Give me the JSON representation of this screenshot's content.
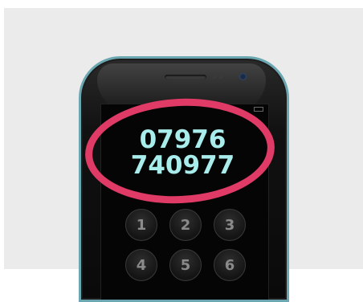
{
  "phone_number": {
    "line1": "07976",
    "line2": "740977"
  },
  "keypad": {
    "keys": [
      "1",
      "2",
      "3",
      "4",
      "5",
      "6"
    ]
  },
  "colors": {
    "highlight": "#e03a67",
    "number": "#a9ecec",
    "phone_trim": "#6aa7b1",
    "background": "#ebebeb"
  },
  "icons": [
    "phone-speaker-icon",
    "phone-camera-icon",
    "battery-icon"
  ]
}
